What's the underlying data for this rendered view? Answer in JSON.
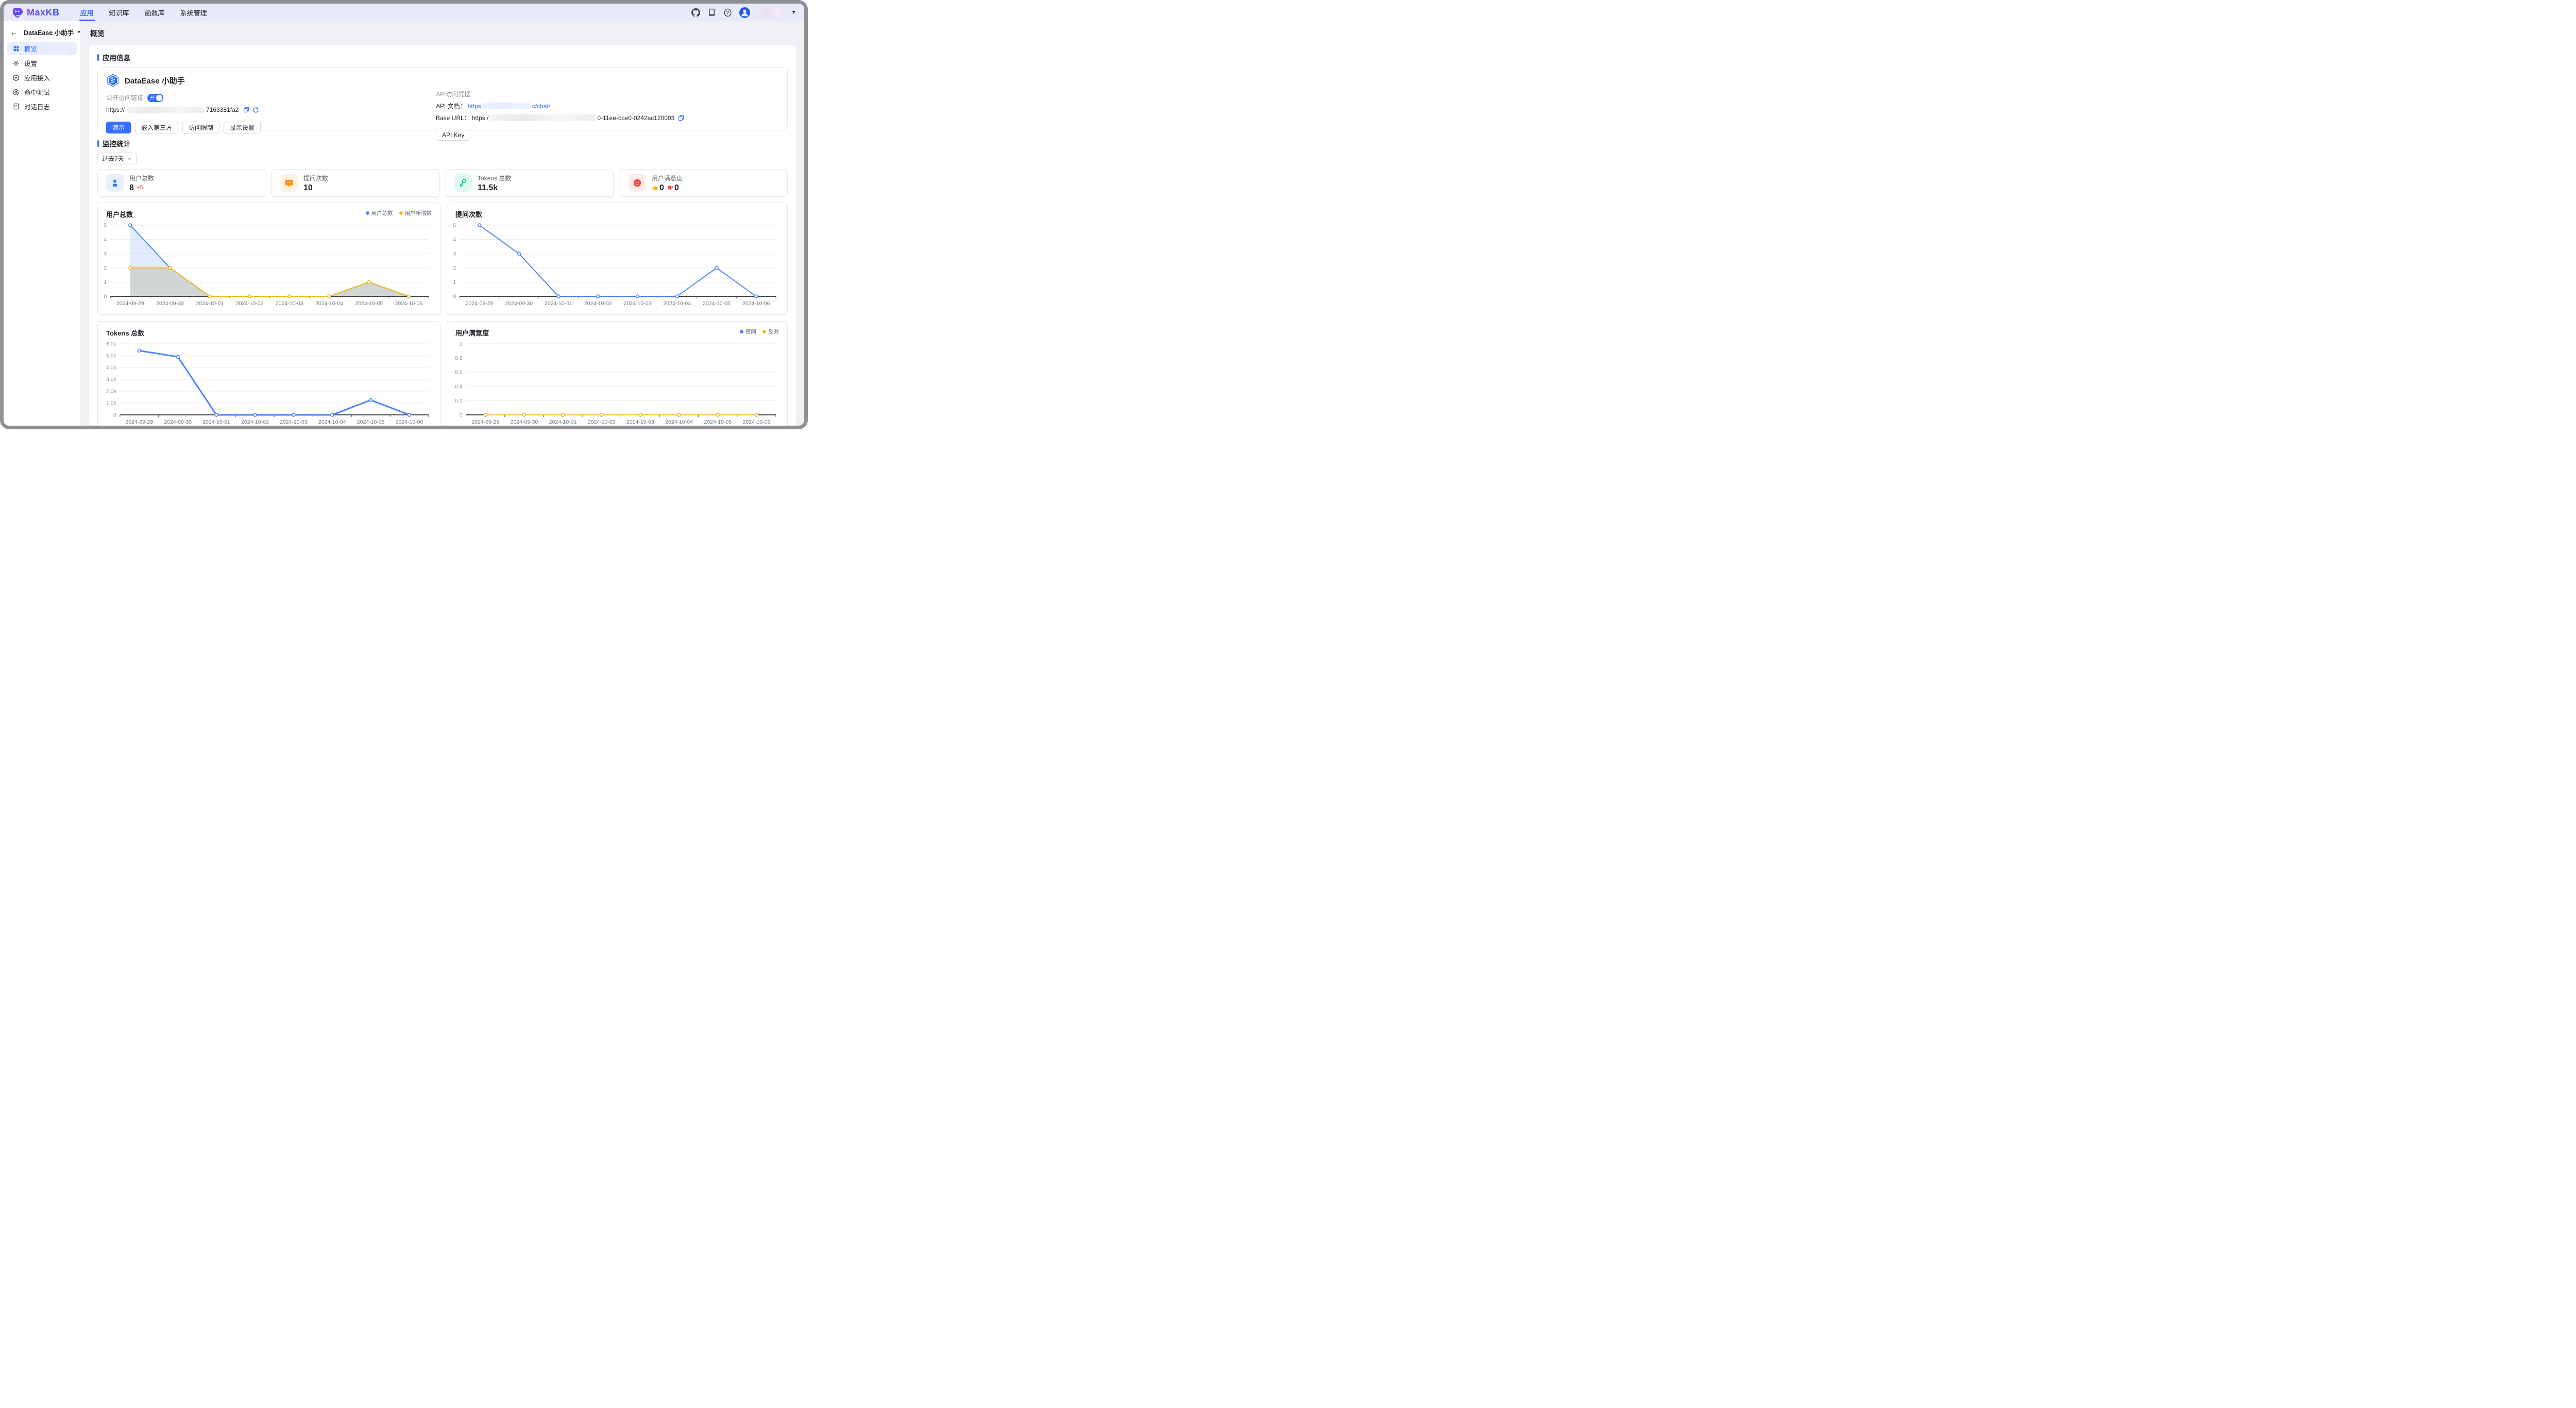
{
  "navbar": {
    "logo_text": "MaxKB",
    "tabs": [
      {
        "label": "应用",
        "active": true
      },
      {
        "label": "知识库",
        "active": false
      },
      {
        "label": "函数库",
        "active": false
      },
      {
        "label": "系统管理",
        "active": false
      }
    ],
    "right_icons": [
      "github-icon",
      "docs-icon",
      "help-icon",
      "avatar",
      "user-menu-caret"
    ]
  },
  "sidebar": {
    "app_name": "DataEase 小助手",
    "items": [
      {
        "label": "概览",
        "icon": "grid-icon",
        "active": true
      },
      {
        "label": "设置",
        "icon": "gear-icon",
        "active": false
      },
      {
        "label": "应用接入",
        "icon": "cube-icon",
        "active": false
      },
      {
        "label": "命中测试",
        "icon": "target-icon",
        "active": false
      },
      {
        "label": "对话日志",
        "icon": "doc-icon",
        "active": false
      }
    ]
  },
  "page": {
    "title": "概览"
  },
  "app_info": {
    "section_title": "应用信息",
    "name": "DataEase 小助手",
    "public_link": {
      "label": "公开访问链接",
      "toggle_state": "开",
      "url_prefix": "https://",
      "url_suffix": "7163381fa2"
    },
    "actions": {
      "demo": "演示",
      "embed": "嵌入第三方",
      "access": "访问限制",
      "display": "显示设置"
    },
    "api": {
      "section_label": "API访问凭据",
      "doc_label": "API 文档：",
      "doc_link_prefix": "https",
      "doc_link_suffix": "c/chat/",
      "base_url_label": "Base URL：",
      "base_url_prefix": "https:/",
      "base_url_suffix": "0-11ee-bce0-0242ac120003",
      "key_button": "API Key"
    }
  },
  "monitor": {
    "section_title": "监控统计",
    "range_selector": "过去7天",
    "stats": [
      {
        "label": "用户总数",
        "value": "8",
        "delta": "+5",
        "icon": "user-icon",
        "icon_color": "#3370ff",
        "icon_bg": "#e8f0ff"
      },
      {
        "label": "提问次数",
        "value": "10",
        "icon": "chat-icon",
        "icon_color": "#ff8800",
        "icon_bg": "#fff1e3"
      },
      {
        "label": "Tokens 总数",
        "value": "11.5k",
        "icon": "key-icon",
        "icon_color": "#00bf9a",
        "icon_bg": "#e1faf2"
      },
      {
        "label": "用户满意度",
        "thumb_up": "0",
        "thumb_down": "0",
        "icon": "smiley-icon",
        "icon_color": "#f2453d",
        "icon_bg": "#fdebea"
      }
    ]
  },
  "chart_data": [
    {
      "type": "line",
      "title": "用户总数",
      "categories": [
        "2024-09-29",
        "2024-09-30",
        "2024-10-01",
        "2024-10-02",
        "2024-10-03",
        "2024-10-04",
        "2024-10-05",
        "2024-10-06"
      ],
      "series": [
        {
          "name": "用户总数",
          "color": "#4e83fd",
          "values": [
            5,
            2,
            0,
            0,
            0,
            0,
            1,
            0
          ],
          "fill": "rgba(78,131,253,0.16)"
        },
        {
          "name": "用户新增数",
          "color": "#f7ba1e",
          "values": [
            2,
            2,
            0,
            0,
            0,
            0,
            1,
            0
          ],
          "fill": "rgba(176,171,134,0.35)"
        }
      ],
      "ylim": [
        0,
        5
      ],
      "yticks": [
        0,
        1,
        2,
        3,
        4,
        5
      ],
      "ytick_labels": [
        "0",
        "1",
        "2",
        "3",
        "4",
        "5"
      ],
      "legend": true,
      "grid": true
    },
    {
      "type": "line",
      "title": "提问次数",
      "categories": [
        "2024-09-29",
        "2024-09-30",
        "2024-10-01",
        "2024-10-02",
        "2024-10-03",
        "2024-10-04",
        "2024-10-05",
        "2024-10-06"
      ],
      "series": [
        {
          "name": "提问次数",
          "color": "#4e83fd",
          "values": [
            5,
            3,
            0,
            0,
            0,
            0,
            2,
            0
          ]
        }
      ],
      "ylim": [
        0,
        5
      ],
      "yticks": [
        0,
        1,
        2,
        3,
        4,
        5
      ],
      "ytick_labels": [
        "0",
        "1",
        "2",
        "3",
        "4",
        "5"
      ],
      "legend": false,
      "grid": true
    },
    {
      "type": "line",
      "title": "Tokens 总数",
      "categories": [
        "2024-09-29",
        "2024-09-30",
        "2024-10-01",
        "2024-10-02",
        "2024-10-03",
        "2024-10-04",
        "2024-10-05",
        "2024-10-06"
      ],
      "series": [
        {
          "name": "Tokens 总数",
          "color": "#4e83fd",
          "values": [
            5420,
            4900,
            0,
            0,
            0,
            0,
            1250,
            0
          ],
          "thick": true
        }
      ],
      "ylim": [
        0,
        6000
      ],
      "yticks": [
        0,
        1000,
        2000,
        3000,
        4000,
        5000,
        6000
      ],
      "ytick_labels": [
        "0",
        "1.0k",
        "2.0k",
        "3.0k",
        "4.0k",
        "5.0k",
        "6.0k"
      ],
      "legend": false,
      "grid": true
    },
    {
      "type": "line",
      "title": "用户满意度",
      "categories": [
        "2024-09-29",
        "2024-09-30",
        "2024-10-01",
        "2024-10-02",
        "2024-10-03",
        "2024-10-04",
        "2024-10-05",
        "2024-10-06"
      ],
      "series": [
        {
          "name": "赞同",
          "color": "#4e83fd",
          "values": [
            0,
            0,
            0,
            0,
            0,
            0,
            0,
            0
          ]
        },
        {
          "name": "反对",
          "color": "#f7ba1e",
          "values": [
            0,
            0,
            0,
            0,
            0,
            0,
            0,
            0
          ]
        }
      ],
      "ylim": [
        0,
        1
      ],
      "yticks": [
        0,
        0.2,
        0.4,
        0.6,
        0.8,
        1
      ],
      "ytick_labels": [
        "0",
        "0.2",
        "0.4",
        "0.6",
        "0.8",
        "1"
      ],
      "legend": true,
      "grid": true
    }
  ],
  "colors": {
    "accent": "#3370ff",
    "navbar_bg": "#e8eafa",
    "page_bg": "#f0f1f5",
    "chart_blue": "#4e83fd",
    "chart_yellow": "#f7ba1e",
    "danger": "#f54a45",
    "thumb_up": "#ffb100",
    "thumb_down": "#f2453d"
  }
}
